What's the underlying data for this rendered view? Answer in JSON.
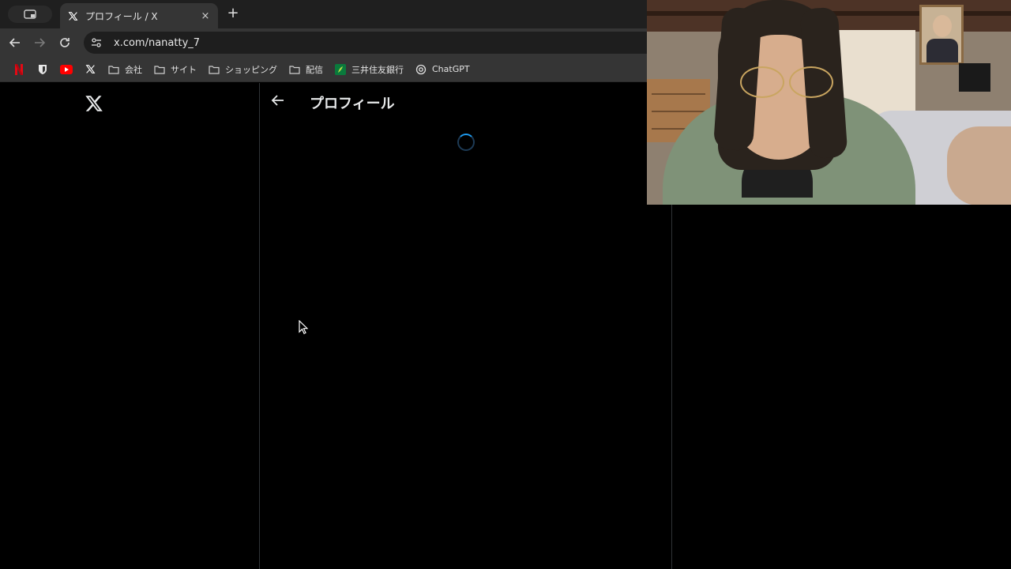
{
  "browser": {
    "tab": {
      "title": "プロフィール / X",
      "close_label": "×"
    },
    "new_tab_label": "+",
    "address": {
      "url": "x.com/nanatty_7"
    },
    "bookmarks": [
      {
        "icon": "netflix-icon",
        "label": ""
      },
      {
        "icon": "bitwarden-icon",
        "label": ""
      },
      {
        "icon": "youtube-icon",
        "label": ""
      },
      {
        "icon": "x-icon",
        "label": ""
      },
      {
        "icon": "folder-icon",
        "label": "会社"
      },
      {
        "icon": "folder-icon",
        "label": "サイト"
      },
      {
        "icon": "folder-icon",
        "label": "ショッピング"
      },
      {
        "icon": "folder-icon",
        "label": "配信"
      },
      {
        "icon": "smbc-icon",
        "label": "三井住友銀行"
      },
      {
        "icon": "chatgpt-icon",
        "label": "ChatGPT"
      }
    ]
  },
  "page": {
    "header_title": "プロフィール",
    "loading": true
  },
  "colors": {
    "accent": "#1d9bf0",
    "page_bg": "#000000",
    "chrome_bg": "#353535",
    "divider": "#2f3336"
  }
}
